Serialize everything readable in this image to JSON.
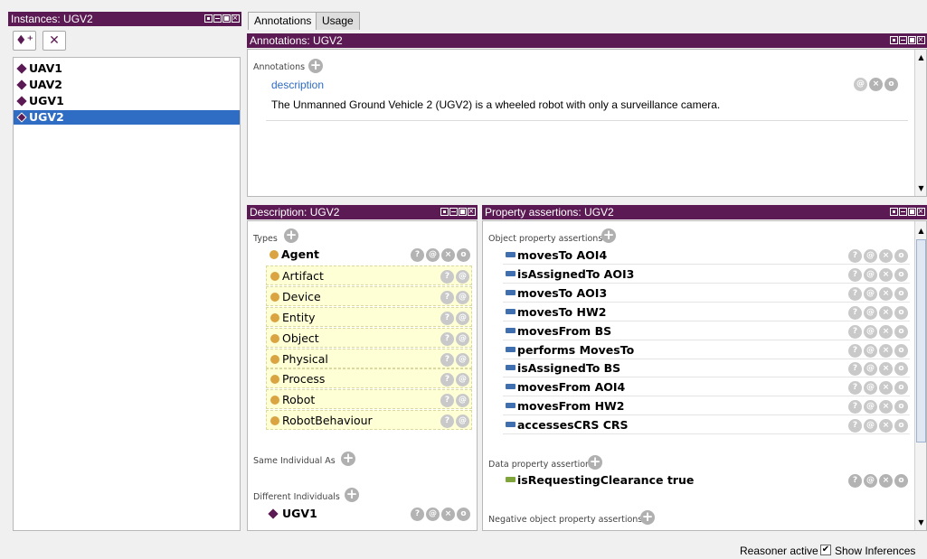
{
  "colors": {
    "accent": "#5b1a53",
    "selection": "#2f6cc4",
    "inferred_bg": "#ffffd6",
    "class_dot": "#d9a441",
    "object_prop": "#3f6fae",
    "data_prop": "#7ea43a"
  },
  "instances": {
    "header": "Instances: UGV2",
    "add_icon": "add-individual-icon",
    "delete_icon": "delete-individual-icon",
    "items": [
      {
        "label": "UAV1",
        "selected": false
      },
      {
        "label": "UAV2",
        "selected": false
      },
      {
        "label": "UGV1",
        "selected": false
      },
      {
        "label": "UGV2",
        "selected": true
      }
    ]
  },
  "tabs": [
    {
      "label": "Annotations",
      "active": true
    },
    {
      "label": "Usage",
      "active": false
    }
  ],
  "annotations": {
    "header": "Annotations: UGV2",
    "section_label": "Annotations",
    "property": "description",
    "value": "The Unmanned Ground Vehicle 2 (UGV2) is a wheeled robot with only a surveillance camera.",
    "buttons": [
      "@",
      "×",
      "o"
    ]
  },
  "description": {
    "header": "Description: UGV2",
    "types_label": "Types",
    "types": [
      {
        "label": "Agent",
        "inferred": false
      },
      {
        "label": "Artifact",
        "inferred": true
      },
      {
        "label": "Device",
        "inferred": true
      },
      {
        "label": "Entity",
        "inferred": true
      },
      {
        "label": "Object",
        "inferred": true
      },
      {
        "label": "Physical",
        "inferred": true
      },
      {
        "label": "Process",
        "inferred": true
      },
      {
        "label": "Robot",
        "inferred": true
      },
      {
        "label": "RobotBehaviour",
        "inferred": true
      }
    ],
    "same_individual_label": "Same Individual As",
    "different_individuals_label": "Different Individuals",
    "different_individuals": [
      {
        "label": "UGV1"
      }
    ],
    "row_buttons": [
      "?",
      "@",
      "×",
      "o"
    ]
  },
  "property_assertions": {
    "header": "Property assertions: UGV2",
    "object_label": "Object property assertions",
    "object_assertions": [
      {
        "property": "movesTo",
        "value": "AOI4"
      },
      {
        "property": "isAssignedTo",
        "value": "AOI3"
      },
      {
        "property": "movesTo",
        "value": "AOI3"
      },
      {
        "property": "movesTo",
        "value": "HW2"
      },
      {
        "property": "movesFrom",
        "value": "BS"
      },
      {
        "property": "performs",
        "value": "MovesTo"
      },
      {
        "property": "isAssignedTo",
        "value": "BS"
      },
      {
        "property": "movesFrom",
        "value": "AOI4"
      },
      {
        "property": "movesFrom",
        "value": "HW2"
      },
      {
        "property": "accessesCRS",
        "value": "CRS"
      }
    ],
    "data_label": "Data property assertions",
    "data_assertions": [
      {
        "property": "isRequestingClearance",
        "value": "true"
      }
    ],
    "negative_label": "Negative object property assertions"
  },
  "status_bar": {
    "reasoner": "Reasoner active",
    "show_inferences_label": "Show Inferences",
    "show_inferences_checked": true
  }
}
